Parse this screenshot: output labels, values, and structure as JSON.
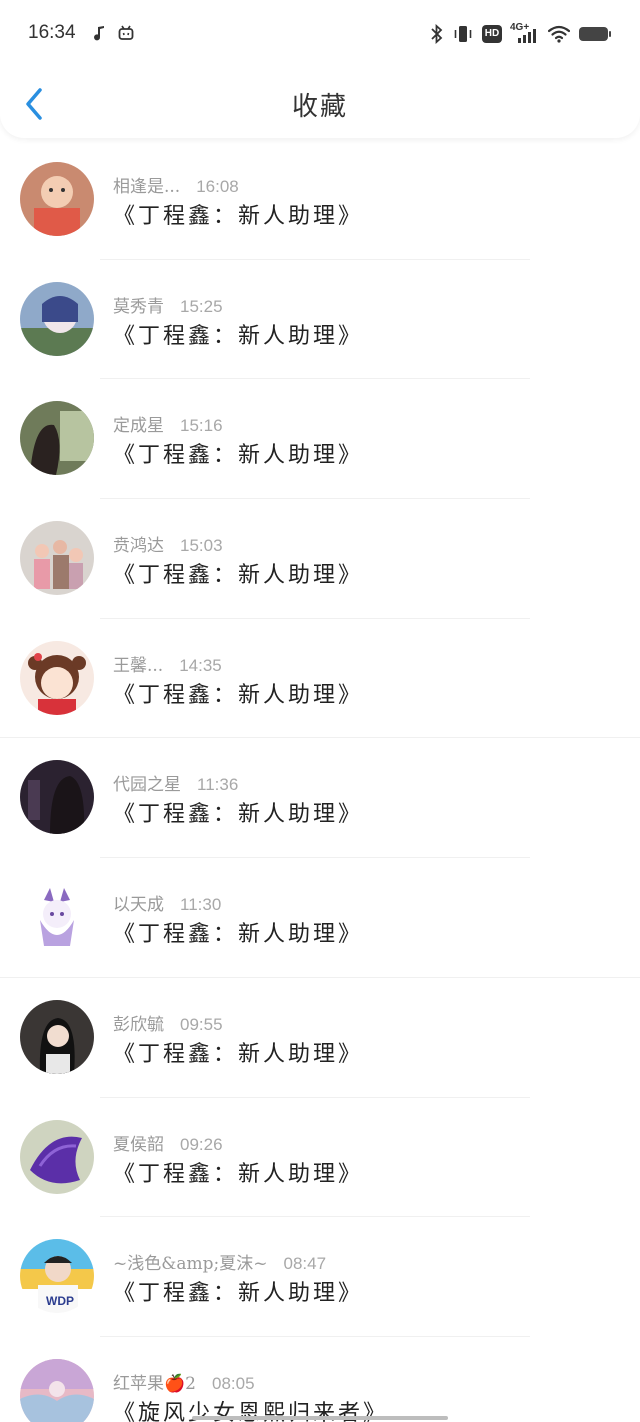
{
  "status_bar": {
    "time": "16:34",
    "icons": [
      "music-note-icon",
      "bilibili-tv-icon",
      "bluetooth-icon",
      "vibrate-icon",
      "hd-icon",
      "signal-4g-icon",
      "wifi-icon",
      "battery-icon"
    ],
    "hd_label": "HD",
    "network_label": "4G+"
  },
  "header": {
    "title": "收藏",
    "back_icon": "chevron-left-icon",
    "accent": "#2a8fe0"
  },
  "items": [
    {
      "name": "相逢是...",
      "time": "16:08",
      "content": "《丁程鑫：新人助理》"
    },
    {
      "name": "莫秀青",
      "time": "15:25",
      "content": "《丁程鑫：新人助理》"
    },
    {
      "name": "定成星",
      "time": "15:16",
      "content": "《丁程鑫：新人助理》"
    },
    {
      "name": "贲鸿达",
      "time": "15:03",
      "content": "《丁程鑫：新人助理》"
    },
    {
      "name": "王馨...",
      "time": "14:35",
      "content": "《丁程鑫：新人助理》"
    },
    {
      "name": "代园之星",
      "time": "11:36",
      "content": "《丁程鑫：新人助理》"
    },
    {
      "name": "以天成",
      "time": "11:30",
      "content": "《丁程鑫：新人助理》"
    },
    {
      "name": "彭欣毓",
      "time": "09:55",
      "content": "《丁程鑫：新人助理》"
    },
    {
      "name": "夏侯韶",
      "time": "09:26",
      "content": "《丁程鑫：新人助理》"
    },
    {
      "name": "~浅色&amp;夏沫~",
      "time": "08:47",
      "content": "《丁程鑫：新人助理》"
    },
    {
      "name": "红苹果🍎2",
      "time": "08:05",
      "content": "《旋风少女恩熙归来者》"
    }
  ]
}
